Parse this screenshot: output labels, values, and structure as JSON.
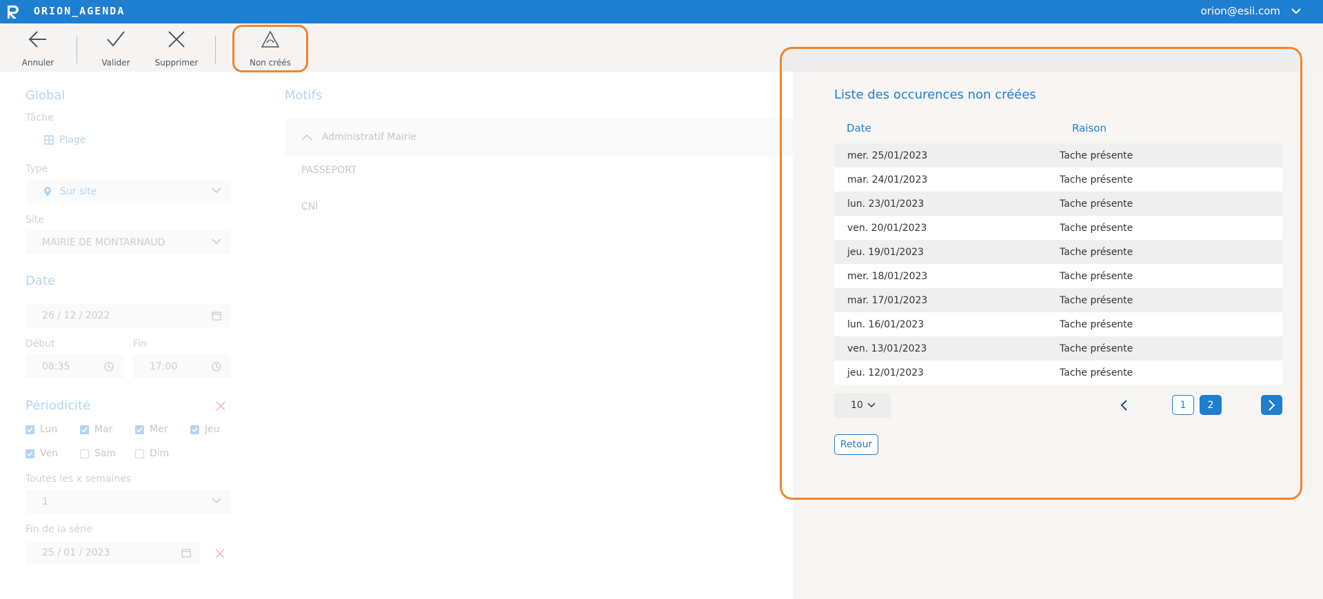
{
  "app": {
    "title": "ORION_AGENDA",
    "user": "orion@esii.com"
  },
  "toolbar": {
    "annuler": "Annuler",
    "valider": "Valider",
    "supprimer": "Supprimer",
    "non_crees": "Non créés"
  },
  "form": {
    "global_title": "Global",
    "tache_label": "Tâche",
    "tache_value": "Plage",
    "type_label": "Type",
    "type_value": "Sur site",
    "site_label": "Site",
    "site_value": "MAIRIE DE MONTARNAUD",
    "date_title": "Date",
    "date_value": "26 / 12 / 2022",
    "debut_label": "Début",
    "debut_value": "08:35",
    "fin_label": "Fin",
    "fin_value": "17:00",
    "periodicite_title": "Périodicité",
    "days": [
      {
        "label": "Lun",
        "checked": true
      },
      {
        "label": "Mar",
        "checked": true
      },
      {
        "label": "Mer",
        "checked": true
      },
      {
        "label": "Jeu",
        "checked": true
      },
      {
        "label": "Ven",
        "checked": true
      },
      {
        "label": "Sam",
        "checked": false
      },
      {
        "label": "Dim",
        "checked": false
      }
    ],
    "weeks_label": "Toutes les x semaines",
    "weeks_value": "1",
    "fin_serie_label": "Fin de la série",
    "fin_serie_value": "25 / 01 / 2023"
  },
  "motifs": {
    "title": "Motifs",
    "group": "Administratif Mairie",
    "items": [
      "PASSEPORT",
      "CNI"
    ]
  },
  "panel": {
    "title": "Liste des occurences non créées",
    "col_date": "Date",
    "col_reason": "Raison",
    "rows": [
      {
        "date": "mer. 25/01/2023",
        "reason": "Tache présente"
      },
      {
        "date": "mar. 24/01/2023",
        "reason": "Tache présente"
      },
      {
        "date": "lun. 23/01/2023",
        "reason": "Tache présente"
      },
      {
        "date": "ven. 20/01/2023",
        "reason": "Tache présente"
      },
      {
        "date": "jeu. 19/01/2023",
        "reason": "Tache présente"
      },
      {
        "date": "mer. 18/01/2023",
        "reason": "Tache présente"
      },
      {
        "date": "mar. 17/01/2023",
        "reason": "Tache présente"
      },
      {
        "date": "lun. 16/01/2023",
        "reason": "Tache présente"
      },
      {
        "date": "ven. 13/01/2023",
        "reason": "Tache présente"
      },
      {
        "date": "jeu. 12/01/2023",
        "reason": "Tache présente"
      }
    ],
    "page_size": "10",
    "pages": [
      "1",
      "2"
    ],
    "current_page": "2",
    "retour": "Retour"
  },
  "colors": {
    "primary": "#1e7ed0",
    "highlight": "#f5832b",
    "danger": "#e53935"
  }
}
